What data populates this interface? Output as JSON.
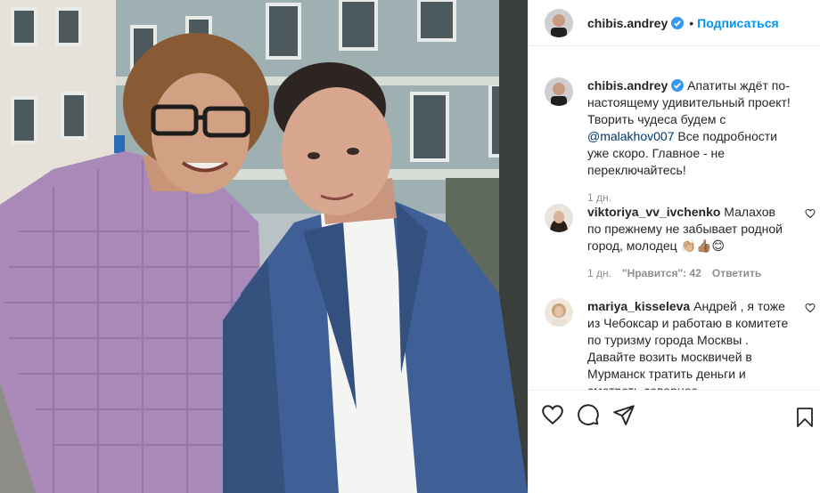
{
  "header": {
    "username": "chibis.andrey",
    "separator": "•",
    "follow_label": "Подписаться"
  },
  "caption": {
    "username": "chibis.andrey",
    "text_before": " Апатиты ждёт по-настоящему удивительный проект! Творить чудеса будем с ",
    "mention": "@malakhov007",
    "text_after": " Все подробности уже скоро. Главное - не переключайтесь!",
    "time": "1 дн."
  },
  "comments": [
    {
      "username": "viktoriya_vv_ivchenko",
      "text": " Малахов по прежнему не забывает родной город, молодец 👏🏼👍🏽😊",
      "time": "1 дн.",
      "likes": "\"Нравится\": 42",
      "reply_label": "Ответить"
    },
    {
      "username": "mariya_kisseleva",
      "text": " Андрей , я тоже из Чебоксар и работаю в комитете по туризму города Москвы . Давайте возить москвичей в Мурманск тратить деньги и смотреть северное"
    }
  ],
  "icons": {
    "verified": "verified-badge",
    "like": "heart-icon",
    "comment": "comment-icon",
    "share": "paper-plane-icon",
    "save": "bookmark-icon"
  },
  "colors": {
    "follow_blue": "#0095f6",
    "verified_blue": "#3897f0",
    "mention_blue": "#00376b",
    "meta_gray": "#8e8e8e"
  }
}
